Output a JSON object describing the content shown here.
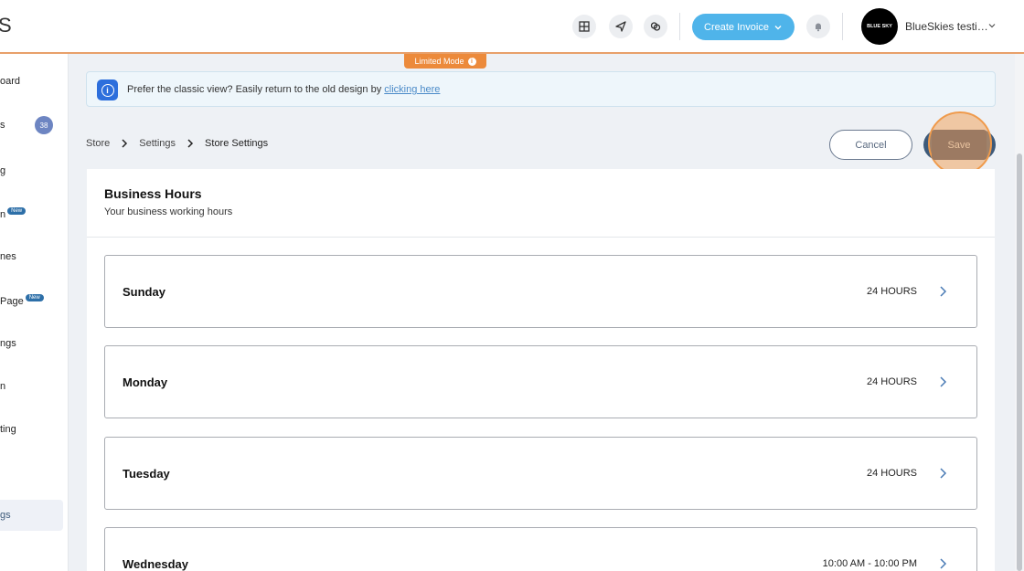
{
  "app": {
    "brand": "S"
  },
  "header": {
    "create_invoice_label": "Create Invoice",
    "account_name": "BlueSkies testi…",
    "avatar_text": "BLUE SKY",
    "icons": [
      "grid-icon",
      "send-icon",
      "link-icon",
      "bell-icon"
    ]
  },
  "sidebar": {
    "items": [
      {
        "label": "oard"
      },
      {
        "label": "s",
        "badge": "38"
      },
      {
        "label": "g"
      },
      {
        "label": "n",
        "new": "New"
      },
      {
        "label": "nes"
      },
      {
        "label": "Page",
        "new": "New"
      },
      {
        "label": "ngs"
      },
      {
        "label": "n"
      },
      {
        "label": "ting"
      },
      {
        "label": "gs",
        "active": true
      }
    ]
  },
  "limited_mode": {
    "label": "Limited Mode",
    "info": "i"
  },
  "banner": {
    "text": "Prefer the classic view? Easily return to the old design by",
    "link": "clicking here",
    "icon": "i"
  },
  "breadcrumb": [
    "Store",
    "Settings",
    "Store Settings"
  ],
  "actions": {
    "cancel": "Cancel",
    "save": "Save"
  },
  "business_hours": {
    "title": "Business Hours",
    "subtitle": "Your business working hours",
    "days": [
      {
        "day": "Sunday",
        "hours": "24 HOURS"
      },
      {
        "day": "Monday",
        "hours": "24 HOURS"
      },
      {
        "day": "Tuesday",
        "hours": "24 HOURS"
      },
      {
        "day": "Wednesday",
        "hours": "10:00 AM - 10:00 PM"
      }
    ]
  },
  "colors": {
    "accent": "#4fb4ea",
    "highlight": "#ef9a4b",
    "limited": "#ec8a3b",
    "save": "#3d5a7a"
  }
}
